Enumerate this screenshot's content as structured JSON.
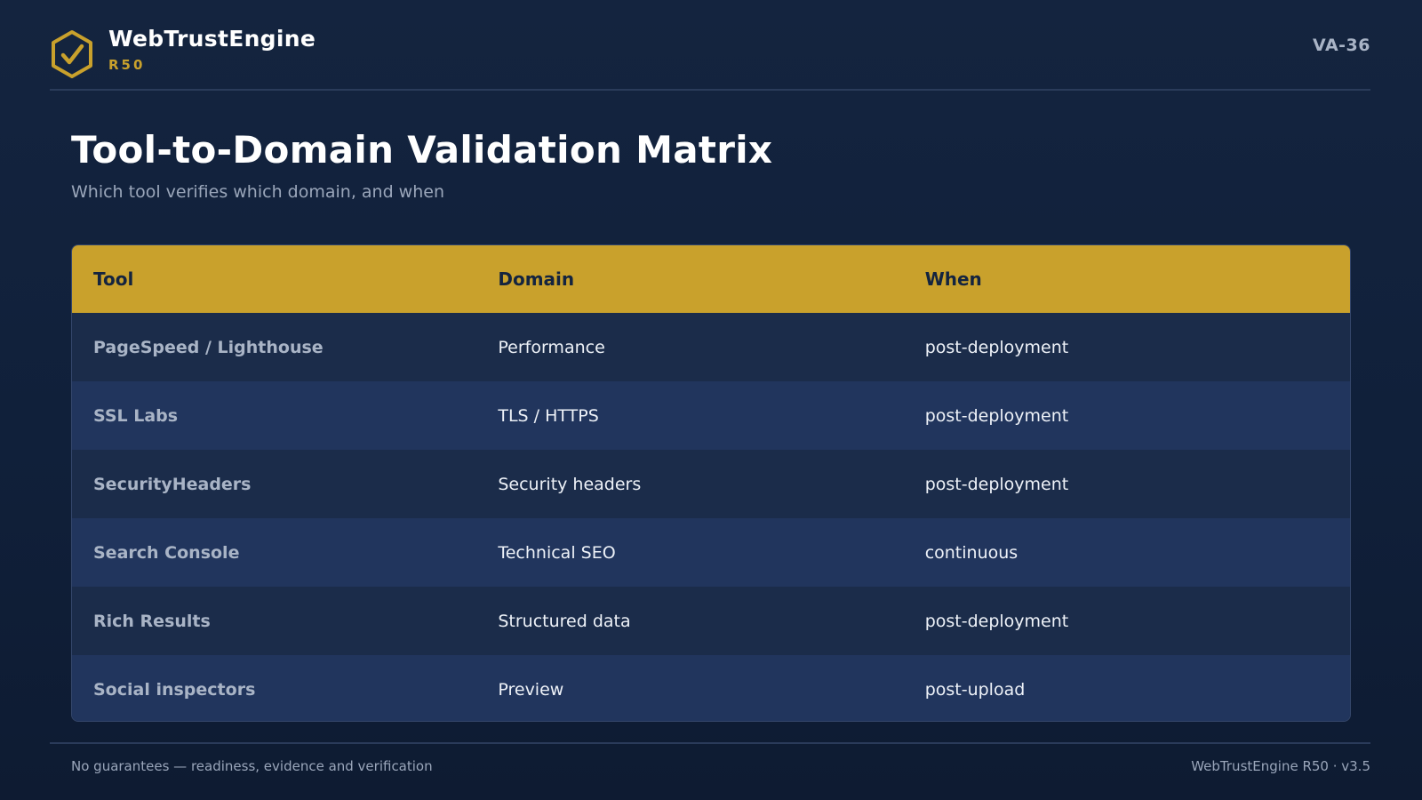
{
  "brand": {
    "name": "WebTrustEngine",
    "release": "R50",
    "logo_icon": "hexagon-check-icon",
    "accent_color": "#c9a12c"
  },
  "header": {
    "doc_id": "VA-36"
  },
  "page": {
    "title": "Tool-to-Domain Validation Matrix",
    "subtitle": "Which tool verifies which domain, and when"
  },
  "table": {
    "columns": [
      "Tool",
      "Domain",
      "When"
    ],
    "rows": [
      {
        "tool": "PageSpeed / Lighthouse",
        "domain": "Performance",
        "when": "post-deployment"
      },
      {
        "tool": "SSL Labs",
        "domain": "TLS / HTTPS",
        "when": "post-deployment"
      },
      {
        "tool": "SecurityHeaders",
        "domain": "Security headers",
        "when": "post-deployment"
      },
      {
        "tool": "Search Console",
        "domain": "Technical SEO",
        "when": "continuous"
      },
      {
        "tool": "Rich Results",
        "domain": "Structured data",
        "when": "post-deployment"
      },
      {
        "tool": "Social inspectors",
        "domain": "Preview",
        "when": "post-upload"
      }
    ]
  },
  "footer": {
    "note": "No guarantees — readiness, evidence and verification",
    "version": "WebTrustEngine R50 · v3.5"
  }
}
